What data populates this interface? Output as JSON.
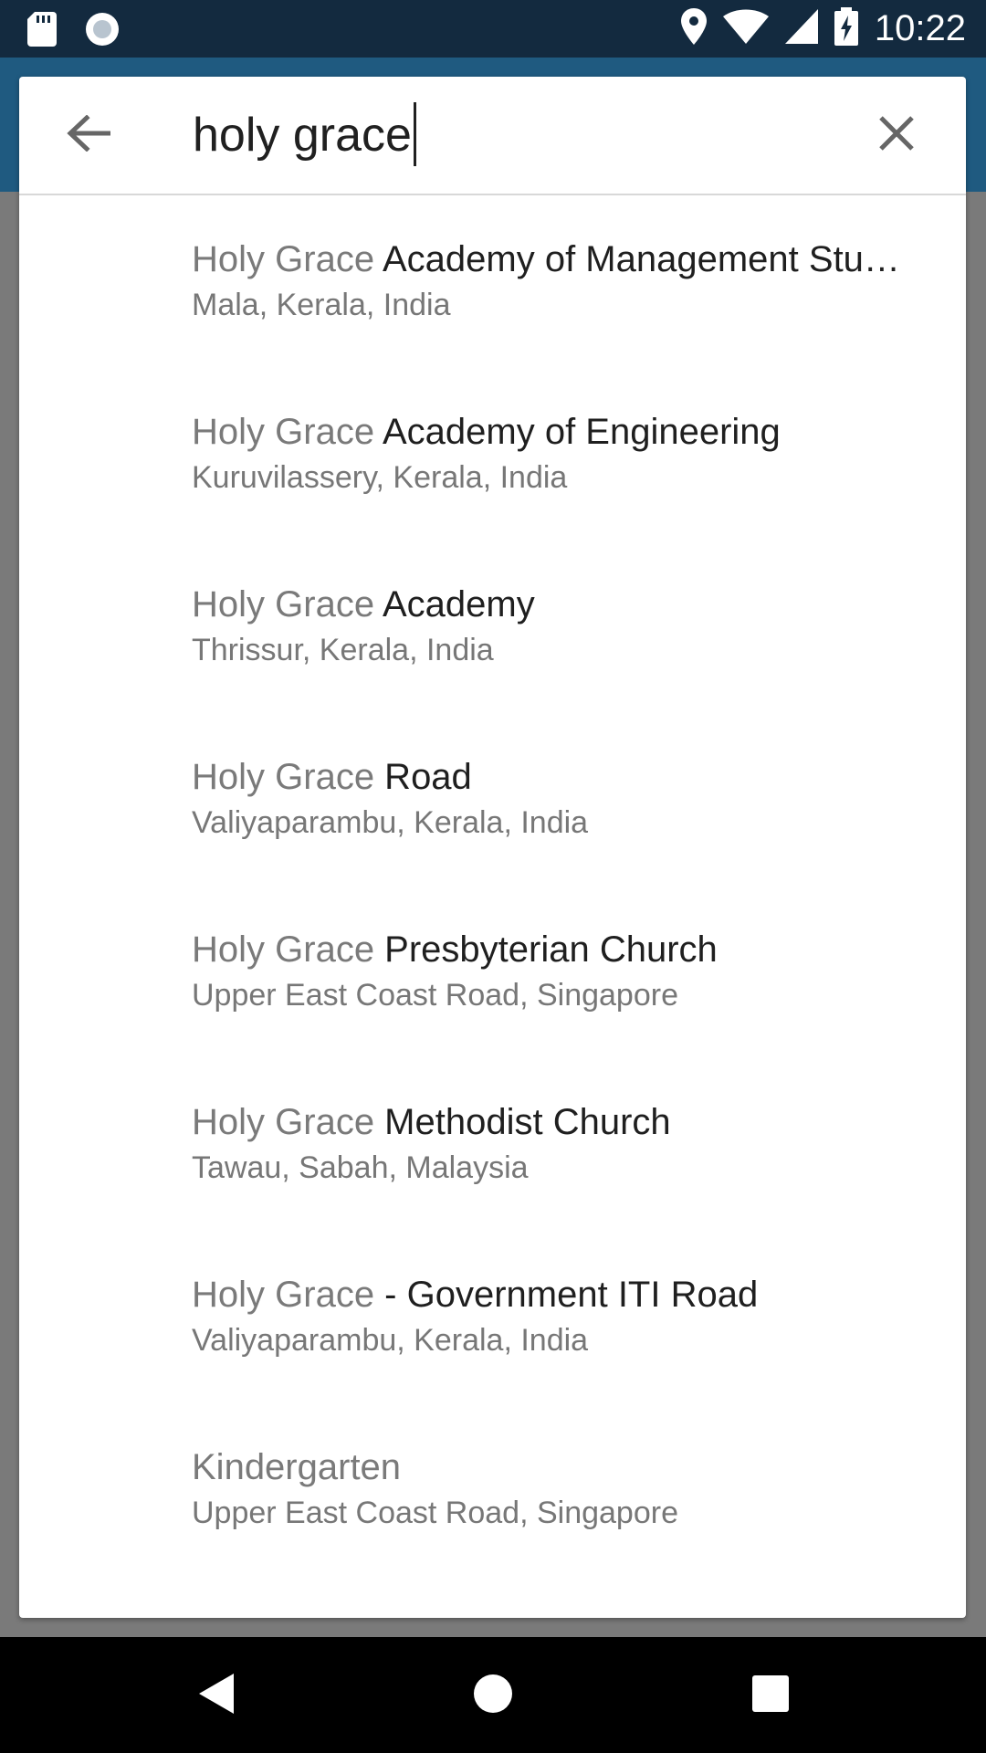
{
  "status_bar": {
    "time": "10:22",
    "icons_left": [
      "sd-card-icon",
      "record-icon"
    ],
    "icons_right": [
      "location-icon",
      "wifi-icon",
      "cell-signal-icon",
      "battery-charging-icon"
    ]
  },
  "search": {
    "query": "holy grace",
    "back_icon": "arrow-left-icon",
    "clear_icon": "close-icon"
  },
  "results": [
    {
      "match": "Holy Grace",
      "rest": " Academy of Management Stu…",
      "sub": "Mala, Kerala, India"
    },
    {
      "match": "Holy Grace",
      "rest": " Academy of Engineering",
      "sub": "Kuruvilassery, Kerala, India"
    },
    {
      "match": "Holy Grace",
      "rest": " Academy",
      "sub": "Thrissur, Kerala, India"
    },
    {
      "match": "Holy Grace",
      "rest": " Road",
      "sub": "Valiyaparambu, Kerala, India"
    },
    {
      "match": "Holy Grace",
      "rest": " Presbyterian Church",
      "sub": "Upper East Coast Road, Singapore"
    },
    {
      "match": "Holy Grace",
      "rest": " Methodist Church",
      "sub": "Tawau, Sabah, Malaysia"
    },
    {
      "match": "Holy Grace",
      "rest": " - Government ITI Road",
      "sub": "Valiyaparambu, Kerala, India"
    },
    {
      "match": "Kindergarten",
      "rest": "",
      "sub": "Upper East Coast Road, Singapore"
    }
  ],
  "nav_bar": {
    "icons": [
      "back-triangle-icon",
      "home-circle-icon",
      "recents-square-icon"
    ]
  },
  "colors": {
    "status_bar": "#132a3f",
    "app_bar": "#1f5a80",
    "scrim": "#7a7a7a",
    "match_text": "#7a7a7a",
    "rest_text": "#1f1f1f"
  }
}
